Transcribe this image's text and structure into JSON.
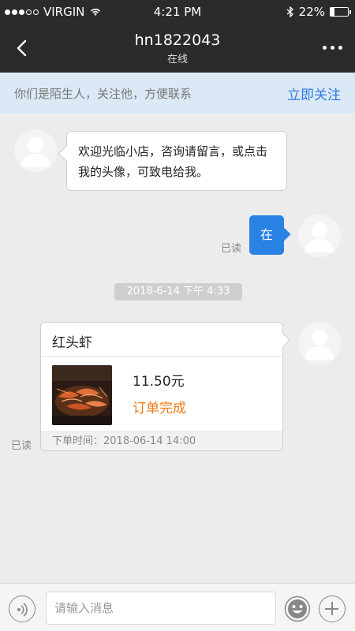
{
  "status_bar": {
    "carrier": "VIRGIN",
    "time": "4:21 PM",
    "battery": "22%",
    "battery_level": 0.22
  },
  "nav": {
    "title": "hn1822043",
    "subtitle": "在线"
  },
  "banner": {
    "tip": "你们是陌生人，关注他，方便联系",
    "follow_label": "立即关注"
  },
  "messages": {
    "welcome": "欢迎光临小店，咨询请留言，或点击我的头像，可致电给我。",
    "outgoing": "在",
    "read_label_1": "已读",
    "timestamp": "2018-6-14 下午 4:33",
    "read_label_2": "已读"
  },
  "order": {
    "title": "红头虾",
    "price": "11.50元",
    "status": "订单完成",
    "footer": "下单时间：2018-06-14 14:00"
  },
  "input": {
    "placeholder": "请输入消息"
  },
  "colors": {
    "accent": "#2a82e4",
    "status_orange": "#f07a1a",
    "bar_dark": "#2b2b2b"
  }
}
